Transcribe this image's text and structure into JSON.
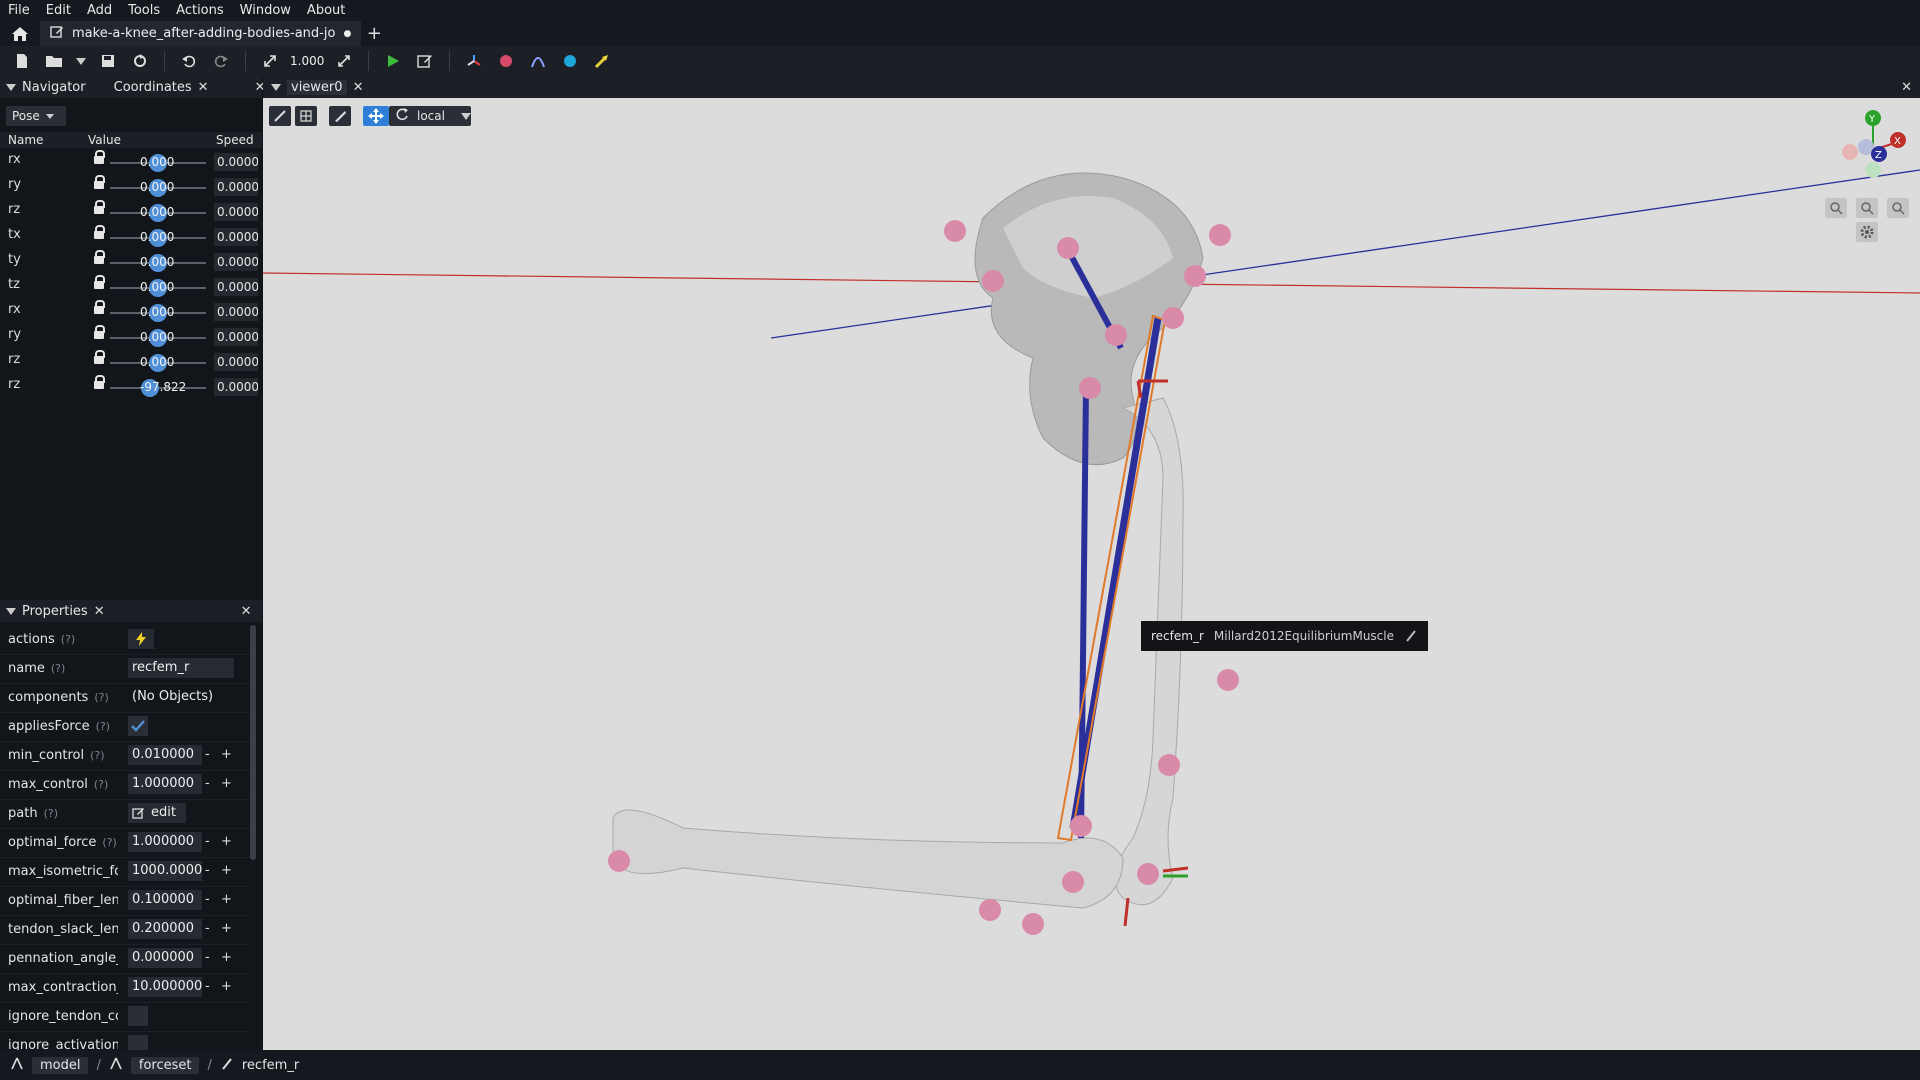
{
  "menu": [
    "File",
    "Edit",
    "Add",
    "Tools",
    "Actions",
    "Window",
    "About"
  ],
  "tab": {
    "title": "make-a-knee_after-adding-bodies-and-jo",
    "modified_dot": "●",
    "plus": "+"
  },
  "toolbar": {
    "scale_value": "1.000"
  },
  "left_top_panel": {
    "tab1": "Navigator",
    "tab2": "Coordinates",
    "mode": "Pose"
  },
  "coords": {
    "headers": {
      "name": "Name",
      "value": "Value",
      "speed": "Speed"
    },
    "rows": [
      {
        "name": "rx",
        "value": "0.000",
        "speed": "0.0000",
        "level": 0.5
      },
      {
        "name": "ry",
        "value": "0.000",
        "speed": "0.0000",
        "level": 0.5
      },
      {
        "name": "rz",
        "value": "0.000",
        "speed": "0.0000",
        "level": 0.5
      },
      {
        "name": "tx",
        "value": "0.000",
        "speed": "0.0000",
        "level": 0.5
      },
      {
        "name": "ty",
        "value": "0.000",
        "speed": "0.0000",
        "level": 0.5
      },
      {
        "name": "tz",
        "value": "0.000",
        "speed": "0.0000",
        "level": 0.5
      },
      {
        "name": "rx",
        "value": "0.000",
        "speed": "0.0000",
        "level": 0.5
      },
      {
        "name": "ry",
        "value": "0.000",
        "speed": "0.0000",
        "level": 0.5
      },
      {
        "name": "rz",
        "value": "0.000",
        "speed": "0.0000",
        "level": 0.5
      },
      {
        "name": "rz",
        "value": "-97.822",
        "speed": "0.0000",
        "level": 0.42
      }
    ]
  },
  "properties": {
    "title": "Properties",
    "rows": [
      {
        "name": "actions",
        "help": "(?)",
        "type": "icon"
      },
      {
        "name": "name",
        "help": "(?)",
        "value": "recfem_r",
        "type": "text"
      },
      {
        "name": "components",
        "help": "(?)",
        "value": "(No Objects)",
        "type": "plain"
      },
      {
        "name": "appliesForce",
        "help": "(?)",
        "type": "check"
      },
      {
        "name": "min_control",
        "help": "(?)",
        "value": "0.010000",
        "type": "num"
      },
      {
        "name": "max_control",
        "help": "(?)",
        "value": "1.000000",
        "type": "num"
      },
      {
        "name": "path",
        "help": "(?)",
        "value": "edit",
        "type": "edit"
      },
      {
        "name": "optimal_force",
        "help": "(?)",
        "value": "1.000000",
        "type": "num"
      },
      {
        "name": "max_isometric_for",
        "help": "",
        "value": "1000.0000",
        "type": "num"
      },
      {
        "name": "optimal_fiber_leng",
        "help": "",
        "value": "0.100000",
        "type": "num"
      },
      {
        "name": "tendon_slack_leng",
        "help": "",
        "value": "0.200000",
        "type": "num"
      },
      {
        "name": "pennation_angle_a",
        "help": "",
        "value": "0.000000",
        "type": "num"
      },
      {
        "name": "max_contraction_v",
        "help": "",
        "value": "10.000000",
        "type": "num"
      },
      {
        "name": "ignore_tendon_cor",
        "help": "",
        "type": "box"
      },
      {
        "name": "ignore_activation",
        "help": "",
        "type": "box"
      }
    ]
  },
  "viewer": {
    "tab": "viewer0",
    "frame": "local",
    "tooltip_name": "recfem_r",
    "tooltip_type": "Millard2012EquilibriumMuscle",
    "axis_x": "X",
    "axis_y": "Y",
    "axis_z": "Z"
  },
  "status": {
    "crumb1": "model",
    "crumb2": "forceset",
    "crumb3": "recfem_r",
    "sep": "/"
  },
  "colors": {
    "accent": "#4f8fd8",
    "ground_red": "#c0302a",
    "ground_blue": "#2a2f9a",
    "muscle_orange": "#e07a2a",
    "marker": "#d98aa8"
  }
}
